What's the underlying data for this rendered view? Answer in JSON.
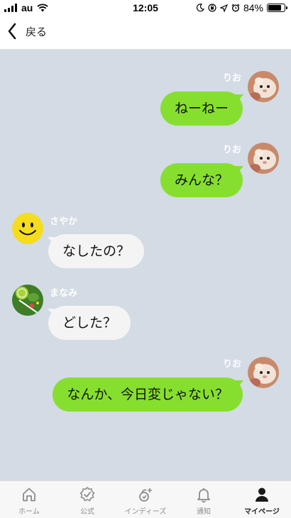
{
  "status_bar": {
    "carrier": "au",
    "time": "12:05",
    "battery": "84%",
    "battery_level": 0.84
  },
  "header": {
    "back_label": "戻る"
  },
  "messages": [
    {
      "sender": "りお",
      "text": "ねーねー",
      "side": "right"
    },
    {
      "sender": "りお",
      "text": "みんな？",
      "side": "right"
    },
    {
      "sender": "さやか",
      "text": "なしたの？",
      "side": "left"
    },
    {
      "sender": "まなみ",
      "text": "どした？",
      "side": "left"
    },
    {
      "sender": "りお",
      "text": "なんか、今日変じゃない？",
      "side": "right"
    }
  ],
  "tabbar": {
    "tabs": [
      {
        "label": "ホーム",
        "icon": "home-icon"
      },
      {
        "label": "公式",
        "icon": "verified-badge-icon"
      },
      {
        "label": "インディーズ",
        "icon": "indies-icon"
      },
      {
        "label": "通知",
        "icon": "bell-icon"
      },
      {
        "label": "マイページ",
        "icon": "person-icon",
        "active": true
      }
    ]
  },
  "colors": {
    "chat_background": "#d3dbe4",
    "my_bubble": "#86df2e",
    "other_bubble": "#f4f4f4"
  }
}
